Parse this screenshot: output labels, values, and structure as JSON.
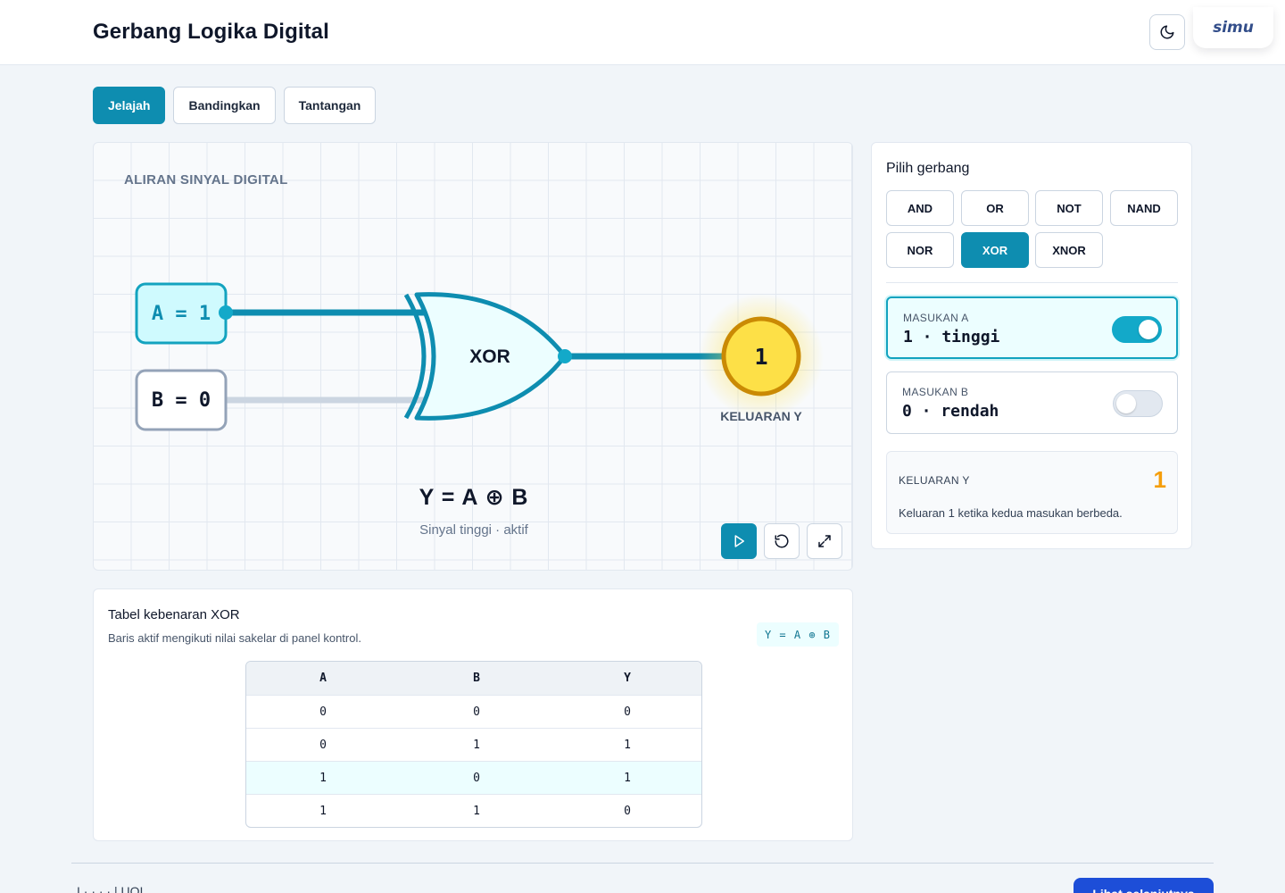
{
  "header": {
    "title": "Gerbang Logika Digital",
    "brand": "simu"
  },
  "tabs": [
    {
      "label": "Jelajah",
      "active": true
    },
    {
      "label": "Bandingkan",
      "active": false
    },
    {
      "label": "Tantangan",
      "active": false
    }
  ],
  "simulation": {
    "flow_label": "ALIRAN SINYAL DIGITAL",
    "input_a_label": "A = 1",
    "input_b_label": "B = 0",
    "gate_label": "XOR",
    "output_value": "1",
    "output_label": "KELUARAN Y",
    "equation": "Y = A ⊕ B",
    "status": "Sinyal tinggi · aktif",
    "colors": {
      "active_wire": "#0e8db0",
      "inactive_wire": "#cbd5e1",
      "output_lamp": "#fde047",
      "lamp_ring": "#ca8a04"
    }
  },
  "controls": [
    {
      "name": "play-icon"
    },
    {
      "name": "reset-icon"
    },
    {
      "name": "fullscreen-icon"
    }
  ],
  "panel": {
    "title": "Pilih gerbang",
    "gates": [
      {
        "label": "AND",
        "active": false
      },
      {
        "label": "OR",
        "active": false
      },
      {
        "label": "NOT",
        "active": false
      },
      {
        "label": "NAND",
        "active": false
      },
      {
        "label": "NOR",
        "active": false
      },
      {
        "label": "XOR",
        "active": true
      },
      {
        "label": "XNOR",
        "active": false
      }
    ],
    "input_a": {
      "label": "MASUKAN A",
      "value": "1 · tinggi",
      "on": true
    },
    "input_b": {
      "label": "MASUKAN B",
      "value": "0 · rendah",
      "on": false
    },
    "output": {
      "label": "KELUARAN Y",
      "value": "1",
      "description": "Keluaran 1 ketika kedua masukan berbeda."
    }
  },
  "truth_table": {
    "title": "Tabel kebenaran XOR",
    "subtitle": "Baris aktif mengikuti nilai sakelar di panel kontrol.",
    "formula": "Y = A ⊕ B",
    "headers": [
      "A",
      "B",
      "Y"
    ],
    "rows": [
      [
        "0",
        "0",
        "0"
      ],
      [
        "0",
        "1",
        "1"
      ],
      [
        "1",
        "0",
        "1"
      ],
      [
        "1",
        "1",
        "0"
      ]
    ],
    "active_row": 2
  },
  "footer": {
    "text": "I  ·  ·  ·  ·   |  UOI",
    "button_label": "Lihat selanjutnya"
  }
}
